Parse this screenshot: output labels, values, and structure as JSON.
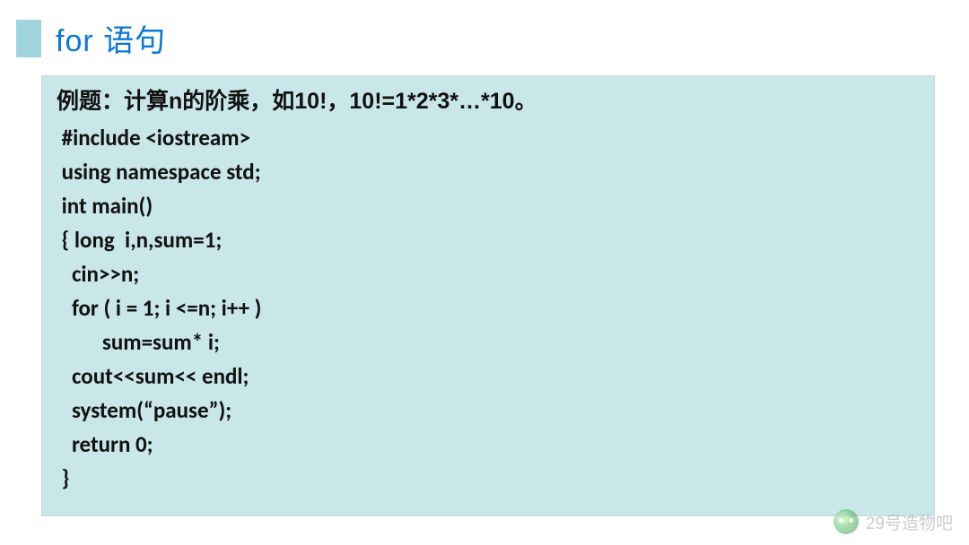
{
  "title": "for  语句",
  "problem": "例题：计算n的阶乘，如10!，10!=1*2*3*…*10。",
  "code": [
    " #include <iostream>",
    " using namespace std;",
    " int main()",
    " { long  i,n,sum=1;",
    "   cin>>n;",
    "   for ( i = 1; i <=n; i++ )",
    "         sum=sum* i;",
    "   cout<<sum<< endl;",
    "   system(“pause”);",
    "   return 0;",
    " }"
  ],
  "watermark": "29号造物吧"
}
